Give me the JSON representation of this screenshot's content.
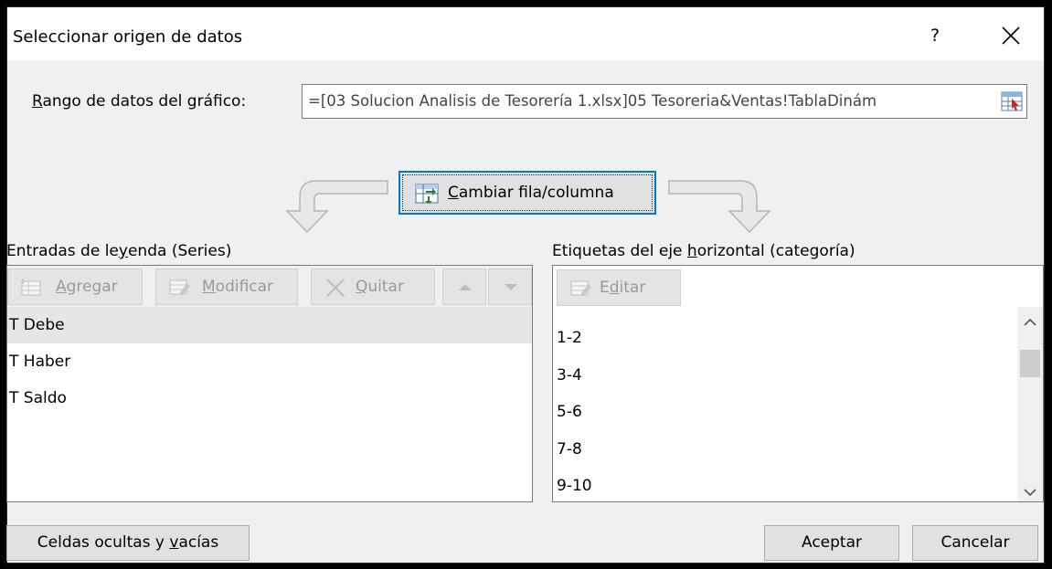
{
  "dialog": {
    "title": "Seleccionar origen de datos",
    "help_label": "?",
    "close_icon": "close-icon"
  },
  "range": {
    "label_prefix": "R",
    "label_rest": "ango de datos del gráfico:",
    "value": "=[03 Solucion Analisis de Tesorería 1.xlsx]05 Tesoreria&Ventas!TablaDinám",
    "picker_icon": "range-picker-icon"
  },
  "switch_button": {
    "label_prefix": "C",
    "label_rest": "ambiar fila/columna",
    "icon": "switch-row-column-icon"
  },
  "series": {
    "section_label_pre": "Entradas de le",
    "section_label_u": "y",
    "section_label_post": "enda (Series)",
    "toolbar": {
      "add_label_u": "A",
      "add_label_rest": "gregar",
      "edit_label_u": "M",
      "edit_label_rest": "odificar",
      "remove_label_u": "Q",
      "remove_label_rest": "uitar"
    },
    "items": [
      "T Debe",
      "T Haber",
      "T Saldo"
    ],
    "selected_index": 0
  },
  "categories": {
    "section_label_pre": "Etiquetas del eje ",
    "section_label_u": "h",
    "section_label_post": "orizontal (categoría)",
    "edit_label_pre": "E",
    "edit_label_u": "d",
    "edit_label_post": "itar",
    "items": [
      "1-2",
      "3-4",
      "5-6",
      "7-8",
      "9-10"
    ]
  },
  "footer": {
    "hidden_cells_pre": "Celdas ocultas y ",
    "hidden_cells_u": "v",
    "hidden_cells_post": "acías",
    "ok_label": "Aceptar",
    "cancel_label": "Cancelar"
  },
  "colors": {
    "focus_border": "#0078d7",
    "dialog_bg": "#f0f0f0",
    "selected_row": "#e6e6e6"
  }
}
